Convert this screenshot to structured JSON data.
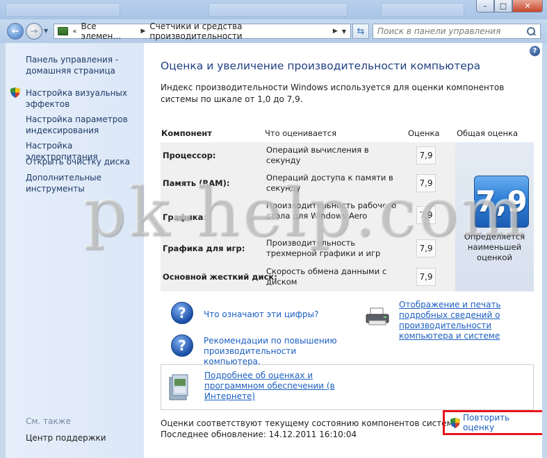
{
  "window": {
    "minimize": "–",
    "maximize": "□",
    "close": "✕"
  },
  "address": {
    "crumb1": "Все элемен…",
    "crumb2": "Счетчики и средства производительности",
    "search_placeholder": "Поиск в панели управления"
  },
  "sidebar": {
    "home": "Панель управления - домашняя страница",
    "items": [
      "Настройка визуальных эффектов",
      "Настройка параметров индексирования",
      "Настройка электропитания",
      "Открыть очистку диска",
      "Дополнительные инструменты"
    ],
    "see_also": "См. также",
    "support": "Центр поддержки"
  },
  "main": {
    "title": "Оценка и увеличение производительности компьютера",
    "intro": "Индекс производительности Windows используется для оценки компонентов системы по шкале от 1,0 до 7,9.",
    "headers": {
      "component": "Компонент",
      "rated": "Что оценивается",
      "score": "Оценка",
      "overall": "Общая оценка"
    },
    "rows": [
      {
        "name": "Процессор:",
        "desc": "Операций вычисления в секунду",
        "score": "7,9"
      },
      {
        "name": "Память (RAM):",
        "desc": "Операций доступа к памяти в секунду",
        "score": "7,9"
      },
      {
        "name": "Графика:",
        "desc": "Производительность рабочего стола для Windows Aero",
        "score": "7,9"
      },
      {
        "name": "Графика для игр:",
        "desc": "Производительность трехмерной графики и игр",
        "score": "7,9"
      },
      {
        "name": "Основной жесткий диск:",
        "desc": "Скорость обмена данными с диском",
        "score": "7,9"
      }
    ],
    "overall_score": "7,9",
    "overall_note": "Определяется наименьшей оценкой",
    "links": {
      "numbers": "Что означают эти цифры?",
      "tips": "Рекомендации по повышению производительности компьютера.",
      "print": "Отображение и печать подробных сведений о производительности компьютера и системе",
      "online": "Подробнее об оценках и программном обеспечении (в Интернете)"
    },
    "status_current": "Оценки соответствуют текущему состоянию компонентов системы",
    "status_updated": "Последнее обновление: 14.12.2011 16:10:04",
    "rerun": "Повторить оценку"
  },
  "watermark": "pk-help.com",
  "colors": {
    "link": "#1a5ec1",
    "title": "#1f3f82",
    "highlight_border": "#e8141c"
  }
}
